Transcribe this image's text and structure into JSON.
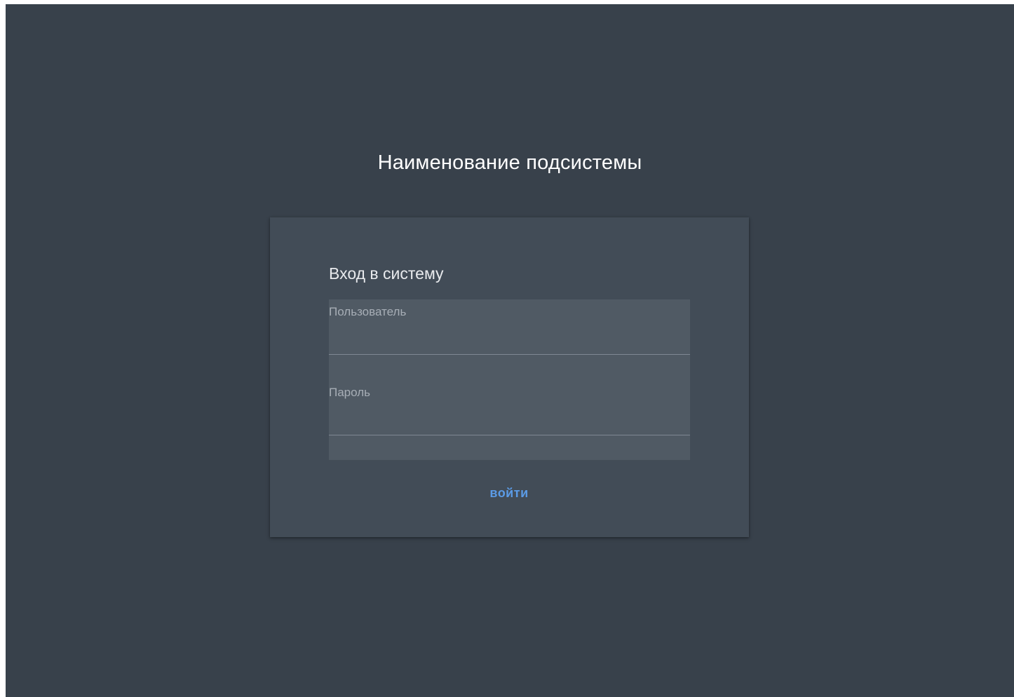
{
  "app": {
    "title": "Наименование подсистемы"
  },
  "login": {
    "heading": "Вход в систему",
    "username": {
      "label": "Пользователь",
      "value": ""
    },
    "password": {
      "label": "Пароль",
      "value": ""
    },
    "submit_label": "войти"
  },
  "colors": {
    "background": "#38414b",
    "card": "#424c57",
    "field_fill": "#505a64",
    "accent": "#5b9be6"
  }
}
